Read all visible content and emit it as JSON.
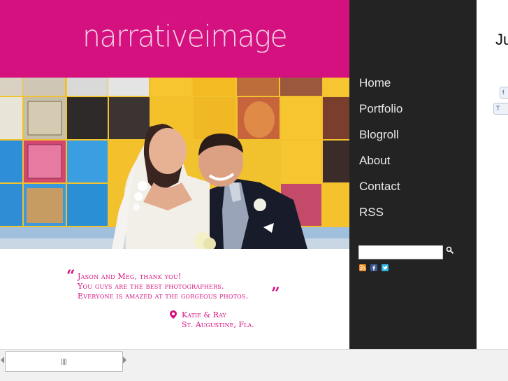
{
  "site": {
    "logo_text": "narrativeimage",
    "brand_color": "#d4117f",
    "sidebar_color": "#232323"
  },
  "nav": {
    "items": [
      {
        "label": "Home"
      },
      {
        "label": "Portfolio"
      },
      {
        "label": "Blogroll"
      },
      {
        "label": "About"
      },
      {
        "label": "Contact"
      },
      {
        "label": "RSS"
      }
    ]
  },
  "search": {
    "value": "",
    "placeholder": "",
    "icon": "search-icon"
  },
  "social_icons": [
    "rss-icon",
    "facebook-icon",
    "twitter-icon"
  ],
  "testimonial": {
    "lines": [
      "Jason and Meg, thank you!",
      "You guys are the best photographers.",
      "Everyone is amazed at the gorgeous photos."
    ],
    "author": "Katie & Ray",
    "location": "St. Augustine, Fla."
  },
  "right_column": {
    "heading_fragment": "Ju",
    "share_buttons": [
      {
        "label": "f",
        "icon": "facebook-icon"
      },
      {
        "label": "T",
        "icon": "twitter-icon"
      }
    ]
  },
  "photo": {
    "alt": "Bride and groom in front of a colorful tile wall"
  }
}
